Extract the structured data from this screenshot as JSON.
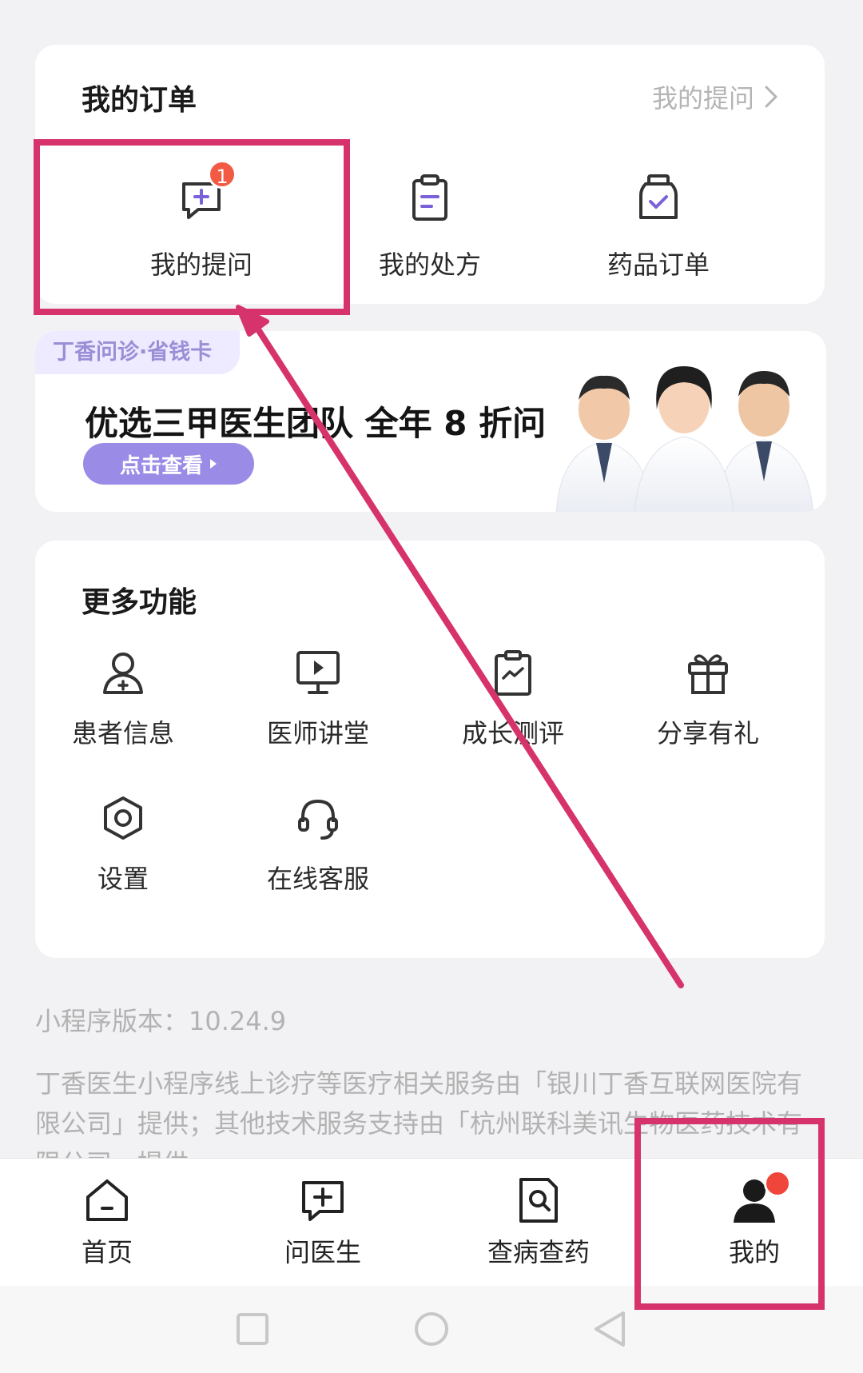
{
  "orders": {
    "title": "我的订单",
    "link_label": "我的提问",
    "items": [
      {
        "label": "我的提问",
        "icon": "question-chat-icon",
        "badge": "1"
      },
      {
        "label": "我的处方",
        "icon": "prescription-clipboard-icon"
      },
      {
        "label": "药品订单",
        "icon": "medicine-bottle-icon"
      }
    ]
  },
  "promo": {
    "tag": "丁香问诊·省钱卡",
    "headline": "优选三甲医生团队 全年 8 折问",
    "button_label": "点击查看"
  },
  "more": {
    "title": "更多功能",
    "items": [
      {
        "label": "患者信息",
        "icon": "patient-add-icon"
      },
      {
        "label": "医师讲堂",
        "icon": "video-lecture-icon"
      },
      {
        "label": "成长测评",
        "icon": "growth-chart-clipboard-icon"
      },
      {
        "label": "分享有礼",
        "icon": "gift-icon"
      },
      {
        "label": "设置",
        "icon": "settings-hexagon-icon"
      },
      {
        "label": "在线客服",
        "icon": "headset-icon"
      }
    ]
  },
  "footer": {
    "version": "小程序版本：10.24.9",
    "disclaimer": "丁香医生小程序线上诊疗等医疗相关服务由「银川丁香互联网医院有限公司」提供；其他技术服务支持由「杭州联科美讯生物医药技术有限公司」提供"
  },
  "tabbar": {
    "items": [
      {
        "label": "首页",
        "icon": "home-icon"
      },
      {
        "label": "问医生",
        "icon": "ask-doctor-icon"
      },
      {
        "label": "查病查药",
        "icon": "search-document-icon"
      },
      {
        "label": "我的",
        "icon": "user-icon",
        "active": true
      }
    ]
  },
  "colors": {
    "highlight": "#d6336c",
    "accent_purple": "#7b61d9",
    "badge_red": "#f25a44"
  }
}
